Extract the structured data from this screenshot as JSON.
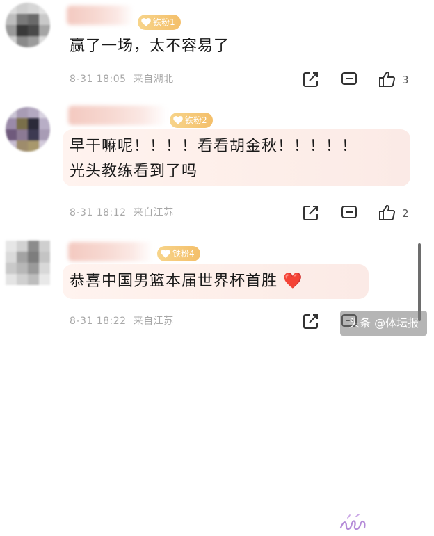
{
  "comments": [
    {
      "badge": "铁粉1",
      "text": "赢了一场，太不容易了",
      "time": "8-31 18:05",
      "location": "来自湖北",
      "like_count": "3"
    },
    {
      "badge": "铁粉2",
      "text_line1": "早干嘛呢！！！！看看胡金秋！！！！！",
      "text_line2": "光头教练看到了吗",
      "time": "8-31 18:12",
      "location": "来自江苏",
      "like_count": "2"
    },
    {
      "badge": "铁粉4",
      "text": "恭喜中国男篮本届世界杯首胜",
      "emoji": "❤️",
      "time": "8-31 18:22",
      "location": "来自江苏",
      "like_count": ""
    }
  ],
  "icons": {
    "share": "share-icon",
    "comment": "comment-icon",
    "like": "thumbs-up-icon",
    "badge": "heart-badge-icon"
  },
  "watermark": "头条 @体坛报",
  "colors": {
    "badge": "#f4bf6a",
    "text": "#1a1a1a",
    "meta": "#a8a8a8",
    "bubble": "#fdeee9"
  }
}
